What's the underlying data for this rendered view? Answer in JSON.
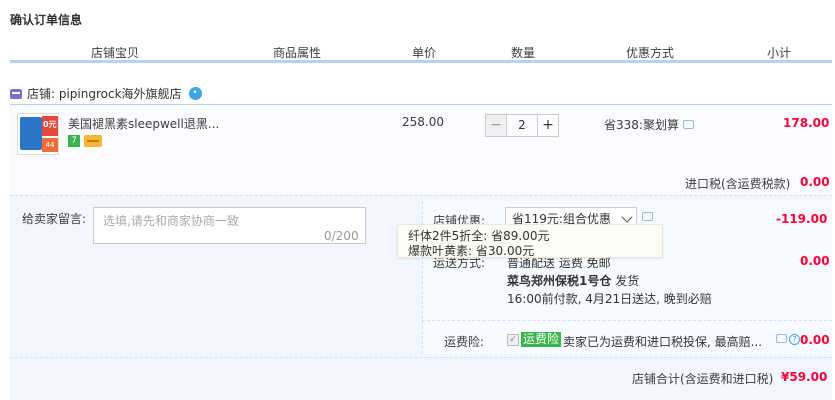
{
  "page_title": "确认订单信息",
  "columns": [
    "店铺宝贝",
    "商品属性",
    "单价",
    "数量",
    "优惠方式",
    "小计"
  ],
  "shop": {
    "label": "店铺: pipingrock海外旗舰店"
  },
  "item": {
    "title": "美国褪黑素sleepwell退黑...",
    "badge_seven": "7",
    "thumb_text": "0元",
    "thumb_sub": "44",
    "unit_price": "258.00",
    "quantity": "2",
    "qty_minus": "−",
    "qty_plus": "+",
    "promo": "省338:聚划算",
    "subtotal": "178.00"
  },
  "import_tax": {
    "label": "进口税(含运费税款)",
    "value": "0.00"
  },
  "message": {
    "label": "给卖家留言:",
    "placeholder": "选填,请先和商家协商一致",
    "counter": "0/200"
  },
  "shop_discount": {
    "label": "店铺优惠:",
    "selected": "省119元:组合优惠",
    "value": "-119.00",
    "tooltip_lines": [
      "纤体2件5折全: 省89.00元",
      "爆款叶黄素: 省30.00元"
    ]
  },
  "shipping": {
    "label": "运送方式:",
    "method": "普通配送 运费 免邮",
    "value": "0.00",
    "warehouse_name": "菜鸟郑州保税1号仓",
    "warehouse_suffix": "发货",
    "delivery": "16:00前付款, 4月21日送达, 晚到必赔"
  },
  "insurance": {
    "label": "运费险:",
    "tag": "运费险",
    "text": "卖家已为运费和进口税投保, 最高赔...",
    "value": "0.00"
  },
  "total": {
    "label": "店铺合计(含运费和进口税)",
    "value": "¥59.00"
  },
  "colors": {
    "price_red": "#ff0036",
    "header_line": "#b2d1ff",
    "badge_green": "#3ab54a"
  },
  "icons": [
    "shop-icon",
    "wangwang-icon",
    "chat-icon",
    "question-icon",
    "check-icon",
    "chevron-down-icon"
  ]
}
